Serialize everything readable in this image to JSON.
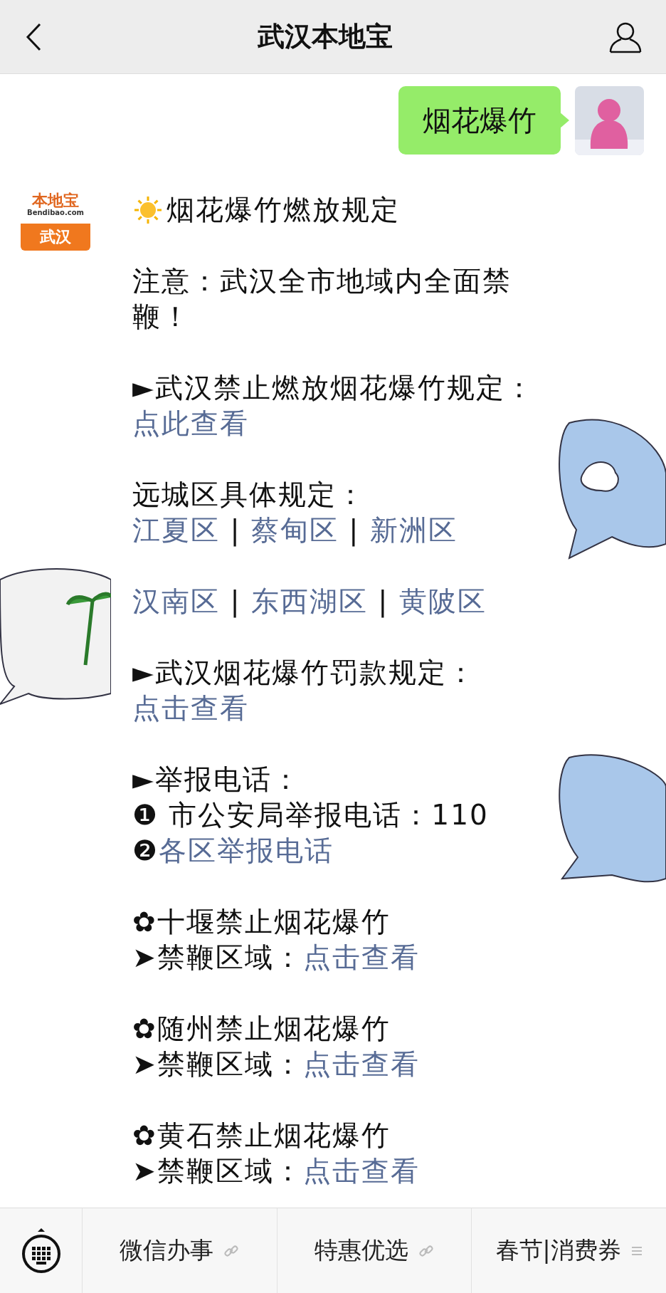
{
  "header": {
    "title": "武汉本地宝"
  },
  "sent_message": {
    "text": "烟花爆竹"
  },
  "account_logo": {
    "brand": "本地宝",
    "domain": "Bendibao.com",
    "city": "武汉"
  },
  "message": {
    "paragraphs": [
      {
        "kind": "heading",
        "lines": [
          [
            {
              "text": "烟花爆竹燃放规定",
              "link": false
            }
          ]
        ]
      },
      {
        "kind": "text",
        "lines": [
          [
            {
              "text": "注意：武汉全市地域内全面禁鞭！",
              "link": false
            }
          ]
        ]
      },
      {
        "kind": "text",
        "lines": [
          [
            {
              "text": "►武汉禁止燃放烟花爆竹规定：",
              "link": false
            },
            {
              "text": "点此查看",
              "link": true
            }
          ]
        ]
      },
      {
        "kind": "text",
        "lines": [
          [
            {
              "text": "远城区具体规定：",
              "link": false
            }
          ],
          [
            {
              "text": "江夏区",
              "link": true
            },
            {
              "text": " | ",
              "link": false
            },
            {
              "text": "蔡甸区",
              "link": true
            },
            {
              "text": " | ",
              "link": false
            },
            {
              "text": "新洲区",
              "link": true
            }
          ]
        ]
      },
      {
        "kind": "text",
        "lines": [
          [
            {
              "text": "汉南区",
              "link": true
            },
            {
              "text": " | ",
              "link": false
            },
            {
              "text": "东西湖区",
              "link": true
            },
            {
              "text": " | ",
              "link": false
            },
            {
              "text": "黄陂区",
              "link": true
            }
          ]
        ]
      },
      {
        "kind": "text",
        "lines": [
          [
            {
              "text": "►武汉烟花爆竹罚款规定：",
              "link": false
            },
            {
              "text": "点击查看",
              "link": true
            }
          ]
        ]
      },
      {
        "kind": "text",
        "lines": [
          [
            {
              "text": "►举报电话：",
              "link": false
            }
          ],
          [
            {
              "text": "❶ 市公安局举报电话：110",
              "link": false
            }
          ],
          [
            {
              "text": "❷",
              "link": false
            },
            {
              "text": "各区举报电话",
              "link": true
            }
          ]
        ]
      },
      {
        "kind": "text",
        "lines": [
          [
            {
              "text": "✿十堰禁止烟花爆竹",
              "link": false
            }
          ],
          [
            {
              "text": "➤禁鞭区域：",
              "link": false
            },
            {
              "text": "点击查看",
              "link": true
            }
          ]
        ]
      },
      {
        "kind": "text",
        "lines": [
          [
            {
              "text": "✿随州禁止烟花爆竹",
              "link": false
            }
          ],
          [
            {
              "text": "➤禁鞭区域：",
              "link": false
            },
            {
              "text": "点击查看",
              "link": true
            }
          ]
        ]
      },
      {
        "kind": "text",
        "lines": [
          [
            {
              "text": "✿黄石禁止烟花爆竹",
              "link": false
            }
          ],
          [
            {
              "text": "➤禁鞭区域：",
              "link": false
            },
            {
              "text": "点击查看",
              "link": true
            }
          ]
        ]
      }
    ]
  },
  "bottom_menu": [
    {
      "label": "微信办事",
      "kind": "link"
    },
    {
      "label": "特惠优选",
      "kind": "link"
    },
    {
      "label": "春节|消费券",
      "kind": "submenu"
    }
  ]
}
